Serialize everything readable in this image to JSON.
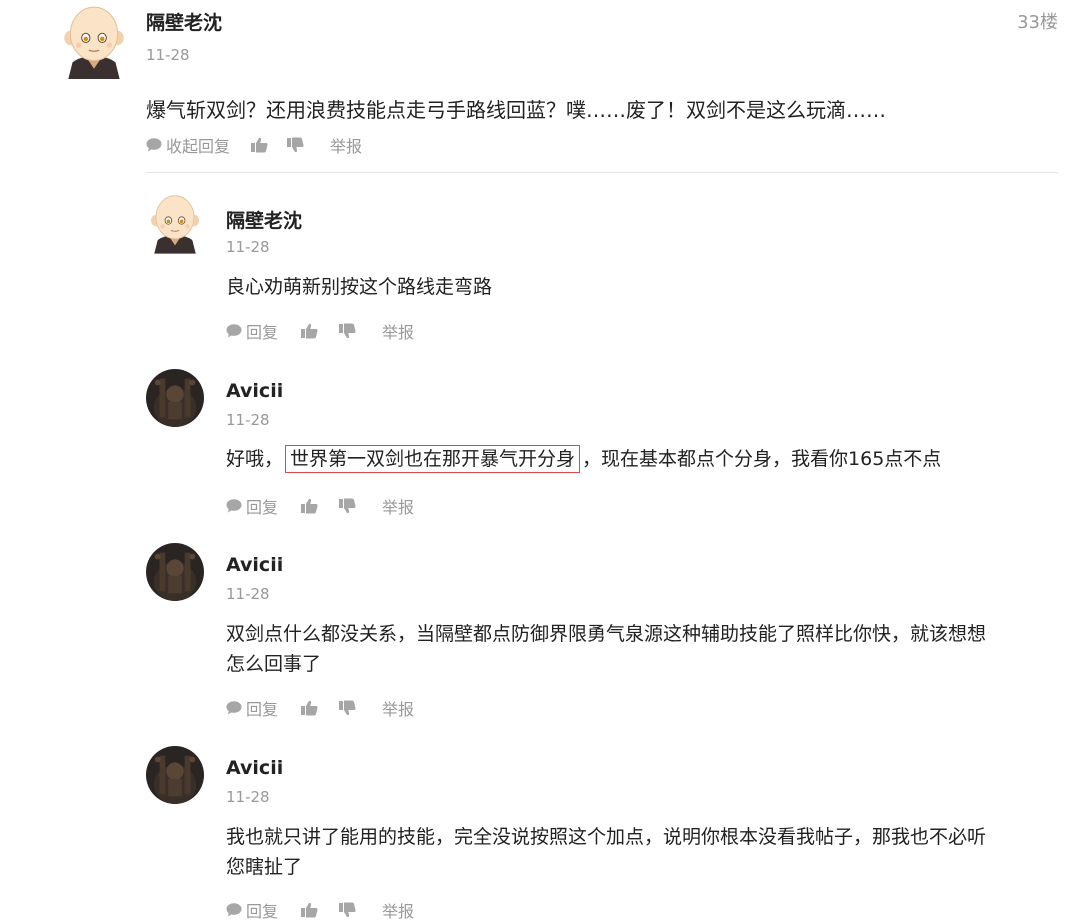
{
  "main": {
    "floor": "33楼",
    "author": "隔壁老沈",
    "date": "11-28",
    "content": "爆气斩双剑？还用浪费技能点走弓手路线回蓝？噗……废了！双剑不是这么玩滴……",
    "actions": {
      "collapse_reply": "收起回复",
      "report": "举报"
    }
  },
  "replies": [
    {
      "author": "隔壁老沈",
      "date": "11-28",
      "lines": [
        "良心劝萌新别按这个路线走弯路"
      ],
      "actions": {
        "reply": "回复",
        "report": "举报"
      }
    },
    {
      "author": "Avicii",
      "date": "11-28",
      "text_before": "好哦，",
      "text_highlight": "世界第一双剑也在那开暴气开分身",
      "text_after": "，现在基本都点个分身，我看你165点不点",
      "actions": {
        "reply": "回复",
        "report": "举报"
      }
    },
    {
      "author": "Avicii",
      "date": "11-28",
      "lines": [
        "双剑点什么都没关系，当隔壁都点防御界限勇气泉源这种辅助技能了照样比你快，就该想想",
        "怎么回事了"
      ],
      "actions": {
        "reply": "回复",
        "report": "举报"
      }
    },
    {
      "author": "Avicii",
      "date": "11-28",
      "lines": [
        "我也就只讲了能用的技能，完全没说按照这个加点，说明你根本没看我帖子，那我也不必听",
        "您瞎扯了"
      ],
      "actions": {
        "reply": "回复",
        "report": "举报"
      }
    }
  ],
  "icons": {
    "speech": "speech-bubble-icon",
    "like": "thumbs-up-icon",
    "dislike": "thumbs-down-icon"
  },
  "colors": {
    "muted": "#999999",
    "highlight_border": "#e0474c",
    "text": "#222222"
  }
}
